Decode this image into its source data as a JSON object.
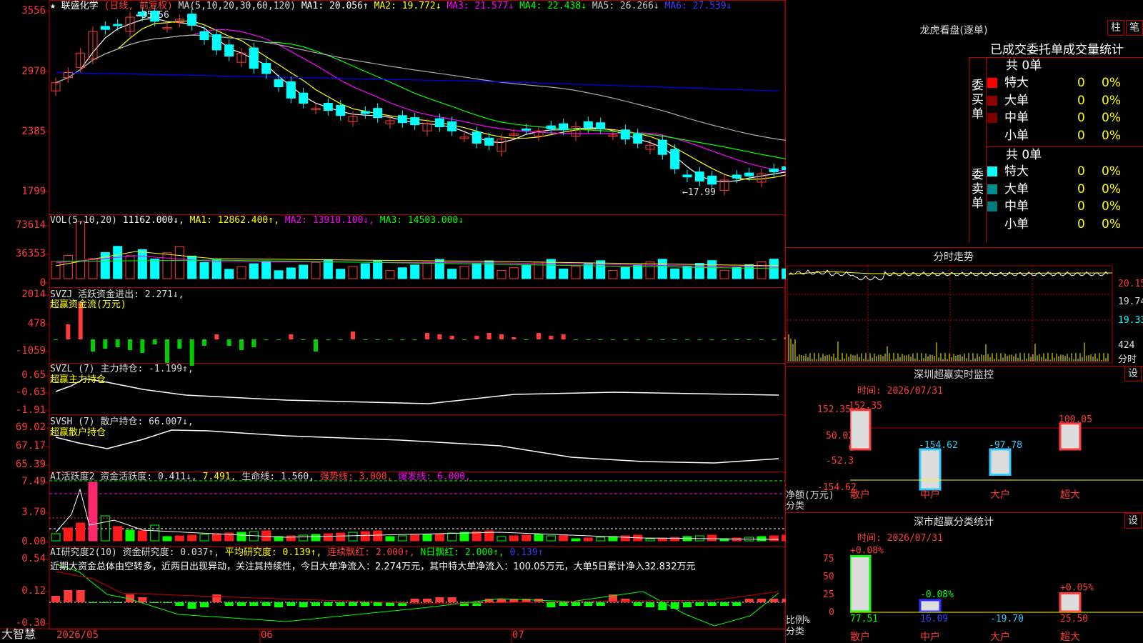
{
  "header": {
    "star": "★",
    "name": "联盛化学",
    "mode": "(日线, 前复权)",
    "ma_label": "MA(5,10,20,30,60,120)",
    "ma1": "MA1: 20.056↑",
    "ma2": "MA2: 19.772↓",
    "ma3": "MA3: 21.577↓",
    "ma4": "MA4: 22.438↓",
    "ma5": "MA5: 26.266↓",
    "ma6": "MA6: 27.539↓"
  },
  "price_axis": [
    "3556",
    "2970",
    "2385",
    "1799"
  ],
  "price_annotations": {
    "high": "35.56",
    "low": "17.99"
  },
  "vol_pane": {
    "axis": [
      "73614",
      "36353",
      "0"
    ],
    "label": "VOL(5,10,20)",
    "value": "11162.000↓,",
    "ma1": "MA1: 12862.400↑,",
    "ma2": "MA2: 13910.100↓,",
    "ma3": "MA3: 14503.000↓"
  },
  "svzj_pane": {
    "axis": [
      "2014",
      "478",
      "-1059"
    ],
    "label": "SVZJ  活跃资金进出: 2.271↓,",
    "sub": "超赢资金流(万元)"
  },
  "svzl_pane": {
    "axis": [
      "0.65",
      "-0.63",
      "-1.91"
    ],
    "label": "SVZL (7) 主力持仓: -1.199↑,",
    "sub": "超赢主力持仓"
  },
  "svsh_pane": {
    "axis": [
      "69.02",
      "67.17",
      "65.39"
    ],
    "label": "SVSH (7) 散户持仓: 66.007↓,",
    "sub": "超赢散户持仓"
  },
  "ai_active": {
    "axis": [
      "7.49",
      "3.70",
      "0.00"
    ],
    "label": "AI活跃度2 资金活跃度: 0.411↓,",
    "v2": "7.491,",
    "life": "生命线: 1.560,",
    "strong": "强势线: 3.000,",
    "burst": "爆发线: 6.000,"
  },
  "ai_research": {
    "axis": [
      "0.54",
      "0.12",
      "-0.30"
    ],
    "label": "AI研究度2(10) 资金研究度: 0.037↑,",
    "avg": "平均研究度: 0.139↑,",
    "lianxu": "连续飘红: 2.000↑,",
    "nday": "N日飘红: 2.000↑,",
    "last": "0.139↑",
    "comment": "近期大资金总体由空转多，近两日出现异动，关注其持续性，今日大单净流入：2.274万元，其中特大单净流入：100.05万元，大单5日累计净入32.832万元"
  },
  "footer": {
    "brand": "大智慧",
    "dates": [
      "2026/05",
      "06",
      "07"
    ]
  },
  "dragon": {
    "title": "龙虎看盘(逐单)",
    "btn1": "柱",
    "btn2": "笔",
    "stat_title": "已成交委托单成交量统计",
    "buy_side": "委买单",
    "sell_side": "委卖单",
    "buy_total": "共 0单",
    "sell_total": "共 0单",
    "buy_rows": [
      {
        "label": "特大",
        "count": "0",
        "pct": "0%",
        "color": "#ff0000"
      },
      {
        "label": "大单",
        "count": "0",
        "pct": "0%",
        "color": "#8b0000"
      },
      {
        "label": "中单",
        "count": "0",
        "pct": "0%",
        "color": "#7a0000"
      },
      {
        "label": "小单",
        "count": "0",
        "pct": "0%",
        "color": ""
      }
    ],
    "sell_rows": [
      {
        "label": "特大",
        "count": "0",
        "pct": "0%",
        "color": "#00ffff"
      },
      {
        "label": "大单",
        "count": "0",
        "pct": "0%",
        "color": "#008b8b"
      },
      {
        "label": "中单",
        "count": "0",
        "pct": "0%",
        "color": "#007a7a"
      },
      {
        "label": "小单",
        "count": "0",
        "pct": "0%",
        "color": ""
      }
    ]
  },
  "intraday": {
    "title": "分时走势",
    "axis": [
      "20.15",
      "19.74",
      "19.33",
      "424",
      "分时"
    ]
  },
  "sz_monitor": {
    "title": "深圳超赢实时监控",
    "set_btn": "设",
    "time": "时间: 2026/07/31",
    "axis": [
      "152.35",
      "50.02",
      "0",
      "-52.3",
      "-154.62"
    ],
    "axis_caption1": "净额(万元)",
    "axis_caption2": "分类",
    "bars": [
      {
        "cat": "散户",
        "value": 152.35,
        "label": "152.35",
        "color": "#ff3b3b"
      },
      {
        "cat": "中户",
        "value": -154.62,
        "label": "-154.62",
        "color": "#33ccff"
      },
      {
        "cat": "大户",
        "value": -97.78,
        "label": "-97.78",
        "color": "#33ccff"
      },
      {
        "cat": "超大",
        "value": 100.05,
        "label": "100.05",
        "color": "#ff3b3b"
      }
    ]
  },
  "sz_class": {
    "title": "深市超赢分类统计",
    "set_btn": "设",
    "time": "时间: 2026/07/31",
    "axis": [
      "75",
      "50",
      "25",
      "0"
    ],
    "axis_caption1": "比例%",
    "axis_caption2": "分类",
    "bars": [
      {
        "cat": "散户",
        "value": 77.51,
        "label": "77.51",
        "top": "+0.08%",
        "color": "#00ff00"
      },
      {
        "cat": "中户",
        "value": 16.09,
        "label": "16.09",
        "top": "-0.08%",
        "color": "#3030ff"
      },
      {
        "cat": "大户",
        "value": 0,
        "label": "-19.70",
        "top": "",
        "color": "#33ccff"
      },
      {
        "cat": "超大",
        "value": 25.5,
        "label": "25.50",
        "top": "+0.05%",
        "color": "#ff3b3b"
      }
    ]
  },
  "colors": {
    "grid": "#b00000",
    "up": "#ff3b3b",
    "down": "#00ffff",
    "ma1": "#ffffff",
    "ma2": "#ffff00",
    "ma3": "#ff00ff",
    "ma4": "#00ff00",
    "ma5": "#aaaaaa",
    "ma6": "#0000ff"
  }
}
